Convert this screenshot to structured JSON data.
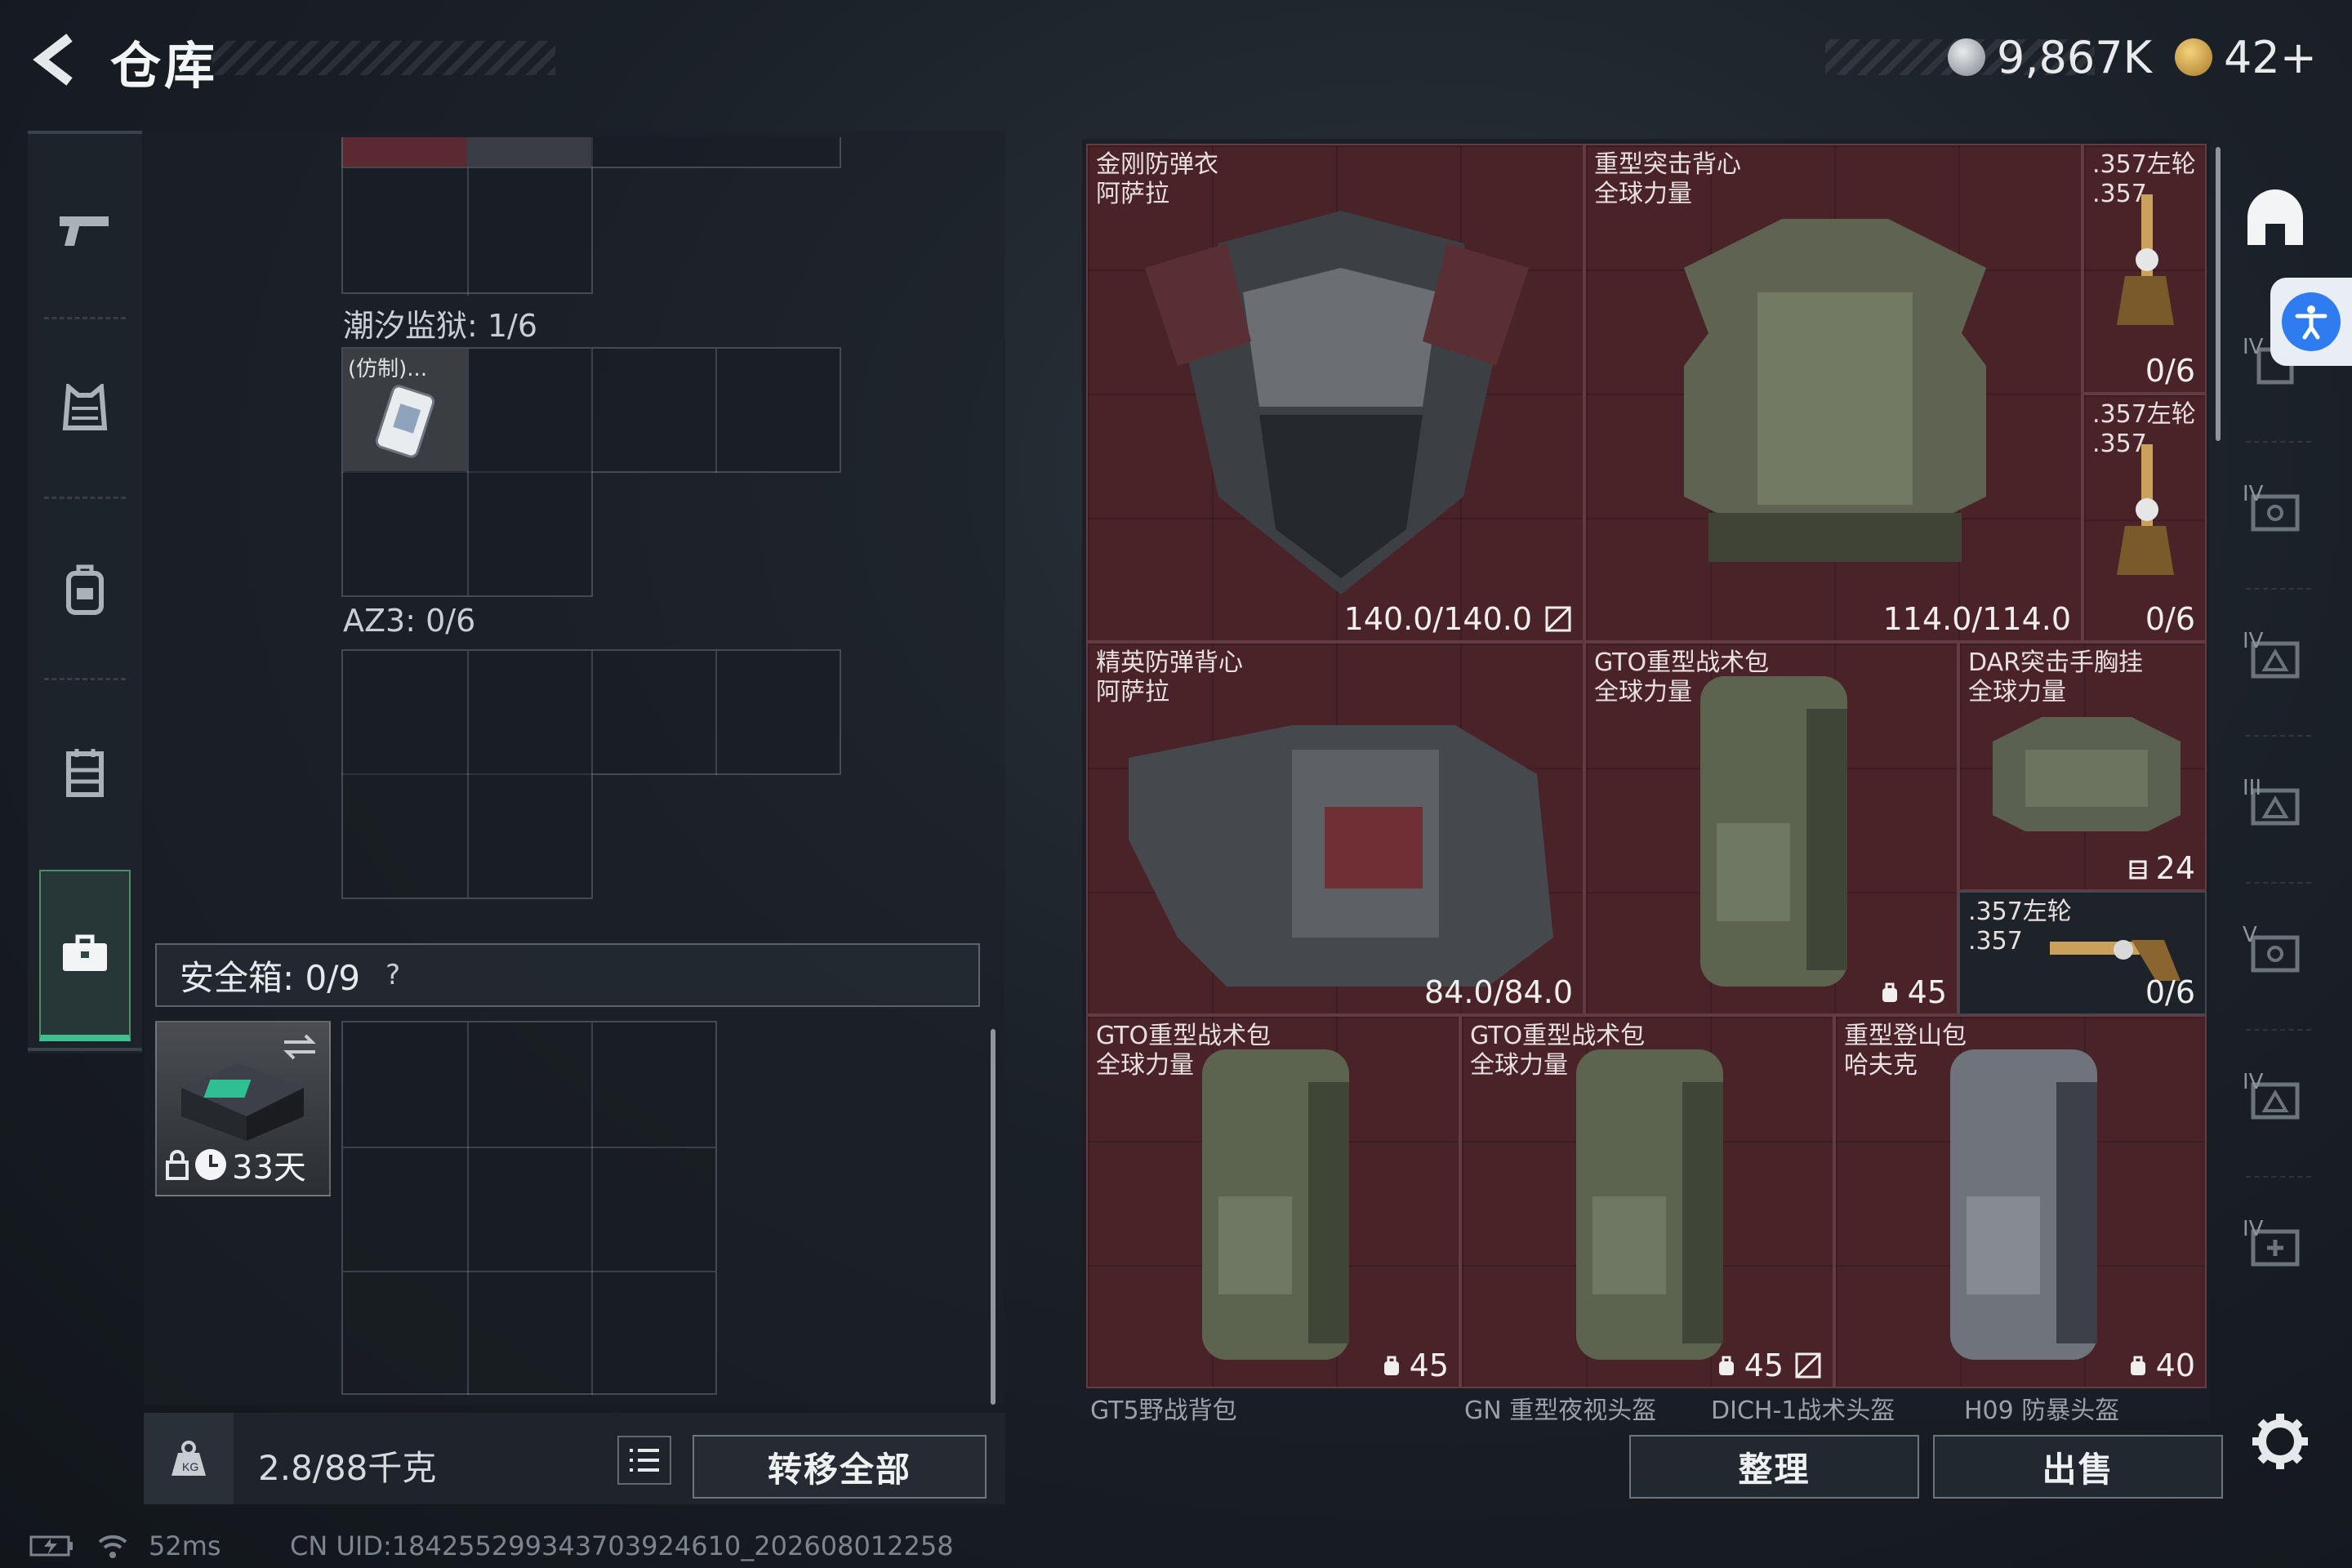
{
  "header": {
    "title": "仓库",
    "currency_primary": "9,867K",
    "currency_secondary": "42+",
    "currency_primary_icon": "silver-coin-icon",
    "currency_secondary_icon": "gold-triangle-coin-icon"
  },
  "left_nav": [
    {
      "name": "weapon-tab",
      "icon": "pistol-icon"
    },
    {
      "name": "armor-tab",
      "icon": "vest-icon"
    },
    {
      "name": "backpack-tab",
      "icon": "backpack-icon"
    },
    {
      "name": "chest-rig-tab",
      "icon": "rig-icon"
    },
    {
      "name": "safe-case-tab",
      "icon": "briefcase-icon",
      "active": true
    }
  ],
  "stash": {
    "grid1_label": "潮汐监狱: 1/6",
    "grid1_item_label": "(仿制)...",
    "grid2_label": "AZ3: 0/6",
    "safe_label": "安全箱: 0/9",
    "safe_help": "?",
    "safe_timer": "33天",
    "weight": "2.8/88千克",
    "transfer_all": "转移全部"
  },
  "items": [
    {
      "name": "金刚防弹衣\n阿萨拉",
      "stat": "140.0/140.0",
      "stat_icon": "no-repair-icon"
    },
    {
      "name": "重型突击背心\n全球力量",
      "stat": "114.0/114.0",
      "stat_icon": ""
    },
    {
      "name": ".357左轮\n.357",
      "stat": "0/6",
      "stat_icon": ""
    },
    {
      "name": ".357左轮\n.357",
      "stat": "0/6",
      "stat_icon": ""
    },
    {
      "name": "精英防弹背心\n阿萨拉",
      "stat": "84.0/84.0",
      "stat_icon": ""
    },
    {
      "name": "GTO重型战术包\n全球力量",
      "stat": "45",
      "stat_icon": "backpack-capacity-icon"
    },
    {
      "name": "DAR突击手胸挂\n全球力量",
      "stat": "24",
      "stat_icon": "rig-capacity-icon"
    },
    {
      "name": ".357左轮\n.357",
      "stat": "0/6",
      "stat_icon": ""
    },
    {
      "name": "GTO重型战术包\n全球力量",
      "stat": "45",
      "stat_icon": "backpack-capacity-icon"
    },
    {
      "name": "GTO重型战术包\n全球力量",
      "stat": "45",
      "stat_icon": "backpack-capacity-icon"
    },
    {
      "name": "重型登山包\n哈夫克",
      "stat": "40",
      "stat_icon": "backpack-capacity-icon"
    }
  ],
  "partial_row": [
    "GT5野战背包",
    "GN 重型夜视头盔",
    "DICH-1战术头盔",
    "H09 防暴头盔"
  ],
  "actions": {
    "sort": "整理",
    "sell": "出售"
  },
  "side_tabs": [
    "helmet-icon",
    "vest-tier-icon",
    "backpack-tier-icon",
    "rig-tier-icon",
    "backpack-tier-icon",
    "vest-tier-icon",
    "rig-tier-icon",
    "medkit-tier-icon"
  ],
  "side_tab_tiers": [
    "IV",
    "IV",
    "IV",
    "III",
    "V",
    "IV",
    "IV"
  ],
  "status": {
    "ping": "52ms",
    "uid": "CN UID:18425529934370392461​0_202608012258"
  }
}
